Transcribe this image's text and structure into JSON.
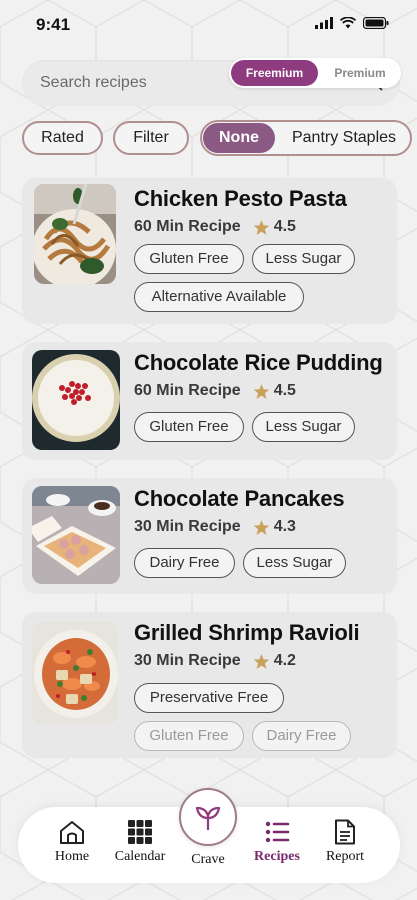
{
  "status_bar": {
    "time": "9:41"
  },
  "search": {
    "placeholder": "Search recipes"
  },
  "tier_toggle": {
    "freemium": "Freemium",
    "premium": "Premium",
    "selected": "Freemium"
  },
  "filters": {
    "rated": "Rated",
    "filter": "Filter",
    "segment": {
      "none": "None",
      "pantry": "Pantry Staples",
      "selected": "None"
    }
  },
  "recipes": [
    {
      "title": "Chicken Pesto Pasta",
      "time": "60 Min Recipe",
      "rating": "4.5",
      "tags": [
        "Gluten Free",
        "Less Sugar",
        "Alternative Available"
      ]
    },
    {
      "title": "Chocolate Rice Pudding",
      "time": "60 Min Recipe",
      "rating": "4.5",
      "tags": [
        "Gluten Free",
        "Less Sugar"
      ]
    },
    {
      "title": "Chocolate Pancakes",
      "time": "30 Min Recipe",
      "rating": "4.3",
      "tags": [
        "Dairy Free",
        "Less Sugar"
      ]
    },
    {
      "title": "Grilled Shrimp Ravioli",
      "time": "30 Min Recipe",
      "rating": "4.2",
      "tags": [
        "Preservative Free",
        "Gluten Free",
        "Dairy Free"
      ]
    }
  ],
  "nav": {
    "home": "Home",
    "calendar": "Calendar",
    "crave": "Crave",
    "recipes": "Recipes",
    "report": "Report",
    "active": "Recipes"
  },
  "colors": {
    "accent": "#8e3c7f",
    "segment_active": "#8b5a84",
    "chip_border": "#b28f8f",
    "star": "#c9a15a",
    "nav_active": "#7a2a6e"
  },
  "icons": [
    "signal-icon",
    "wifi-icon",
    "battery-icon",
    "search-icon",
    "star-icon",
    "home-icon",
    "calendar-icon",
    "sprout-icon",
    "list-icon",
    "report-icon"
  ]
}
